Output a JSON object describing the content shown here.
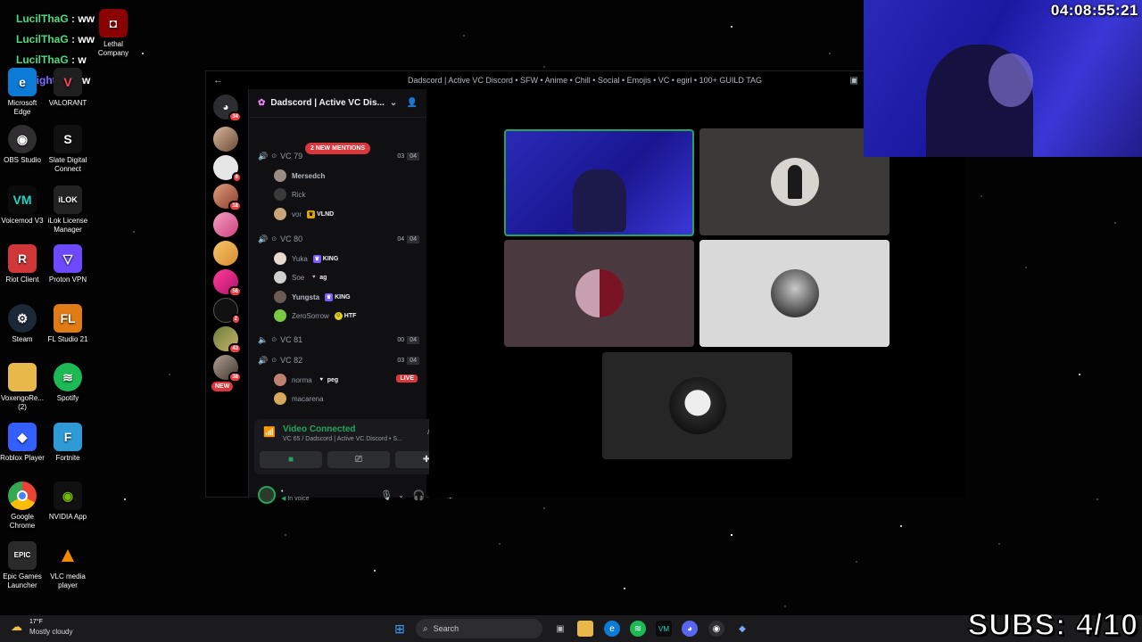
{
  "stream_overlay": {
    "timer": "04:08:55:21",
    "subs": "SUBS: 4/10"
  },
  "chat_overlay": [
    {
      "user": "LucilThaG",
      "msg": "ww",
      "color": "#4ade80"
    },
    {
      "user": "LucilThaG",
      "msg": "ww",
      "color": "#4ade80"
    },
    {
      "user": "LucilThaG",
      "msg": "w",
      "color": "#4ade80"
    },
    {
      "user": "Nightbot",
      "msg": "w",
      "color": "#7c6cff"
    }
  ],
  "desktop_icons": [
    {
      "label": "Microsoft Edge",
      "icon": "edge-icon",
      "color": "#0c7bd5"
    },
    {
      "label": "VALORANT",
      "icon": "valorant-icon",
      "color": "#1f1f1f"
    },
    {
      "label": "Lethal Company",
      "icon": "lethal-company-icon",
      "color": "#8b0000"
    },
    {
      "label": "OBS Studio",
      "icon": "obs-icon",
      "color": "#302e31"
    },
    {
      "label": "Slate Digital Connect",
      "icon": "slate-digital-icon",
      "color": "#111111"
    },
    {
      "label": "Voicemod V3",
      "icon": "voicemod-icon",
      "color": "#0b0b0b"
    },
    {
      "label": "iLok License Manager",
      "icon": "ilok-icon",
      "color": "#222222"
    },
    {
      "label": "Riot Client",
      "icon": "riot-icon",
      "color": "#d13639"
    },
    {
      "label": "Proton VPN",
      "icon": "proton-vpn-icon",
      "color": "#6d4aff"
    },
    {
      "label": "Steam",
      "icon": "steam-icon",
      "color": "#1b2838"
    },
    {
      "label": "FL Studio 21",
      "icon": "fl-studio-icon",
      "color": "#e07b16"
    },
    {
      "label": "VoxengoRe... (2)",
      "icon": "folder-icon",
      "color": "#e8b94a"
    },
    {
      "label": "Spotify",
      "icon": "spotify-icon",
      "color": "#1db954"
    },
    {
      "label": "Roblox Player",
      "icon": "roblox-icon",
      "color": "#335fff"
    },
    {
      "label": "Fortnite",
      "icon": "fortnite-icon",
      "color": "#2f9bd6"
    },
    {
      "label": "Google Chrome",
      "icon": "chrome-icon",
      "color": "#ea4335"
    },
    {
      "label": "NVIDIA App",
      "icon": "nvidia-icon",
      "color": "#76b900"
    },
    {
      "label": "Epic Games Launcher",
      "icon": "epic-games-icon",
      "color": "#2a2a2a"
    },
    {
      "label": "VLC media player",
      "icon": "vlc-icon",
      "color": "#f08a00"
    }
  ],
  "discord": {
    "window_title": "Dadscord | Active VC Discord • SFW • Anime • Chill • Social • Emojis • VC • egirl • 100+ GUILD TAG",
    "server_name": "Dadscord | Active VC Dis...",
    "guild_badges": [
      "34",
      "6",
      "18",
      "56",
      "2",
      "43",
      "38"
    ],
    "new_label": "NEW",
    "mentions_pill": "2 NEW MENTIONS",
    "channels": [
      {
        "name": "VC 79",
        "count": "03",
        "limit": "04",
        "members": [
          {
            "name": "Mersedch",
            "tag": ""
          },
          {
            "name": "Rick",
            "tag": ""
          },
          {
            "name": "vor",
            "tag": "VLND"
          }
        ]
      },
      {
        "name": "VC 80",
        "count": "04",
        "limit": "04",
        "members": [
          {
            "name": "Yuka",
            "tag": "KING"
          },
          {
            "name": "Soe",
            "tag": "ag"
          },
          {
            "name": "Yungsta",
            "tag": "KING"
          },
          {
            "name": "ZeroSorrow",
            "tag": "HTF"
          }
        ]
      },
      {
        "name": "VC 81",
        "count": "00",
        "limit": "04",
        "members": []
      },
      {
        "name": "VC 82",
        "count": "03",
        "limit": "04",
        "members": [
          {
            "name": "norma",
            "tag": "peg",
            "live": "LIVE"
          },
          {
            "name": "macarena",
            "tag": ""
          }
        ]
      }
    ],
    "voice_panel": {
      "status": "Video Connected",
      "sub": "VC 65 / Dadscord | Active VC Discord • S..."
    },
    "user_status": "In voice"
  },
  "taskbar": {
    "weather_temp": "17°F",
    "weather_desc": "Mostly cloudy",
    "search_placeholder": "Search"
  }
}
